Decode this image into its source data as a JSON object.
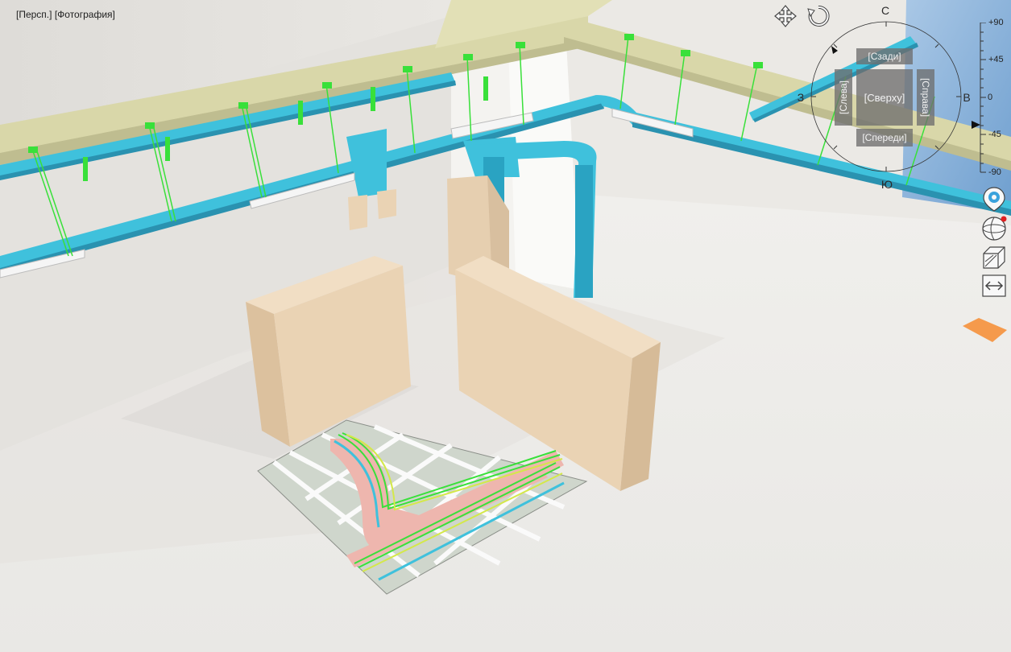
{
  "viewport": {
    "view_mode": "[Персп.]",
    "render_mode": "[Фотография]"
  },
  "navigation": {
    "pan_icon": "pan-icon",
    "orbit_icon": "orbit-icon"
  },
  "compass": {
    "north": "С",
    "south": "Ю",
    "west": "З",
    "east": "В"
  },
  "viewcube": {
    "back": "[Сзади]",
    "top": "[Сверху]",
    "front": "[Спереди]",
    "left": "[Слева]",
    "right": "[Справа]"
  },
  "tilt": {
    "ticks": [
      "+90",
      "+45",
      "0",
      "-45",
      "-90"
    ]
  },
  "side_tools": {
    "location_icon": "location-pin-icon",
    "globe_icon": "globe-icon",
    "section_icon": "section-box-icon",
    "measure_icon": "measure-icon"
  },
  "colors": {
    "cable_tray": "#3fc1dc",
    "hangers": "#39e03a",
    "panels": "#ead3b4",
    "floor_cable_pink": "#eeb6ae",
    "beam": "#d9d7a9"
  }
}
